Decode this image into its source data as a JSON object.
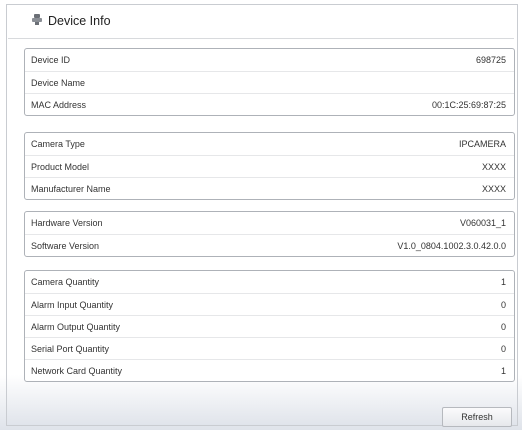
{
  "header": {
    "title": "Device Info"
  },
  "groups": [
    {
      "rows": [
        {
          "label": "Device ID",
          "value": "698725"
        },
        {
          "label": "Device Name",
          "value": ""
        },
        {
          "label": "MAC Address",
          "value": "00:1C:25:69:87:25"
        }
      ]
    },
    {
      "rows": [
        {
          "label": "Camera Type",
          "value": "IPCAMERA"
        },
        {
          "label": "Product Model",
          "value": "XXXX"
        },
        {
          "label": "Manufacturer Name",
          "value": "XXXX"
        }
      ]
    },
    {
      "rows": [
        {
          "label": "Hardware Version",
          "value": "V060031_1"
        },
        {
          "label": "Software Version",
          "value": "V1.0_0804.1002.3.0.42.0.0"
        }
      ]
    },
    {
      "rows": [
        {
          "label": "Camera Quantity",
          "value": "1"
        },
        {
          "label": "Alarm Input Quantity",
          "value": "0"
        },
        {
          "label": "Alarm Output Quantity",
          "value": "0"
        },
        {
          "label": "Serial Port Quantity",
          "value": "0"
        },
        {
          "label": "Network Card Quantity",
          "value": "1"
        }
      ]
    }
  ],
  "actions": {
    "refresh_label": "Refresh"
  },
  "icons": {
    "title_icon": "device-info-icon"
  }
}
